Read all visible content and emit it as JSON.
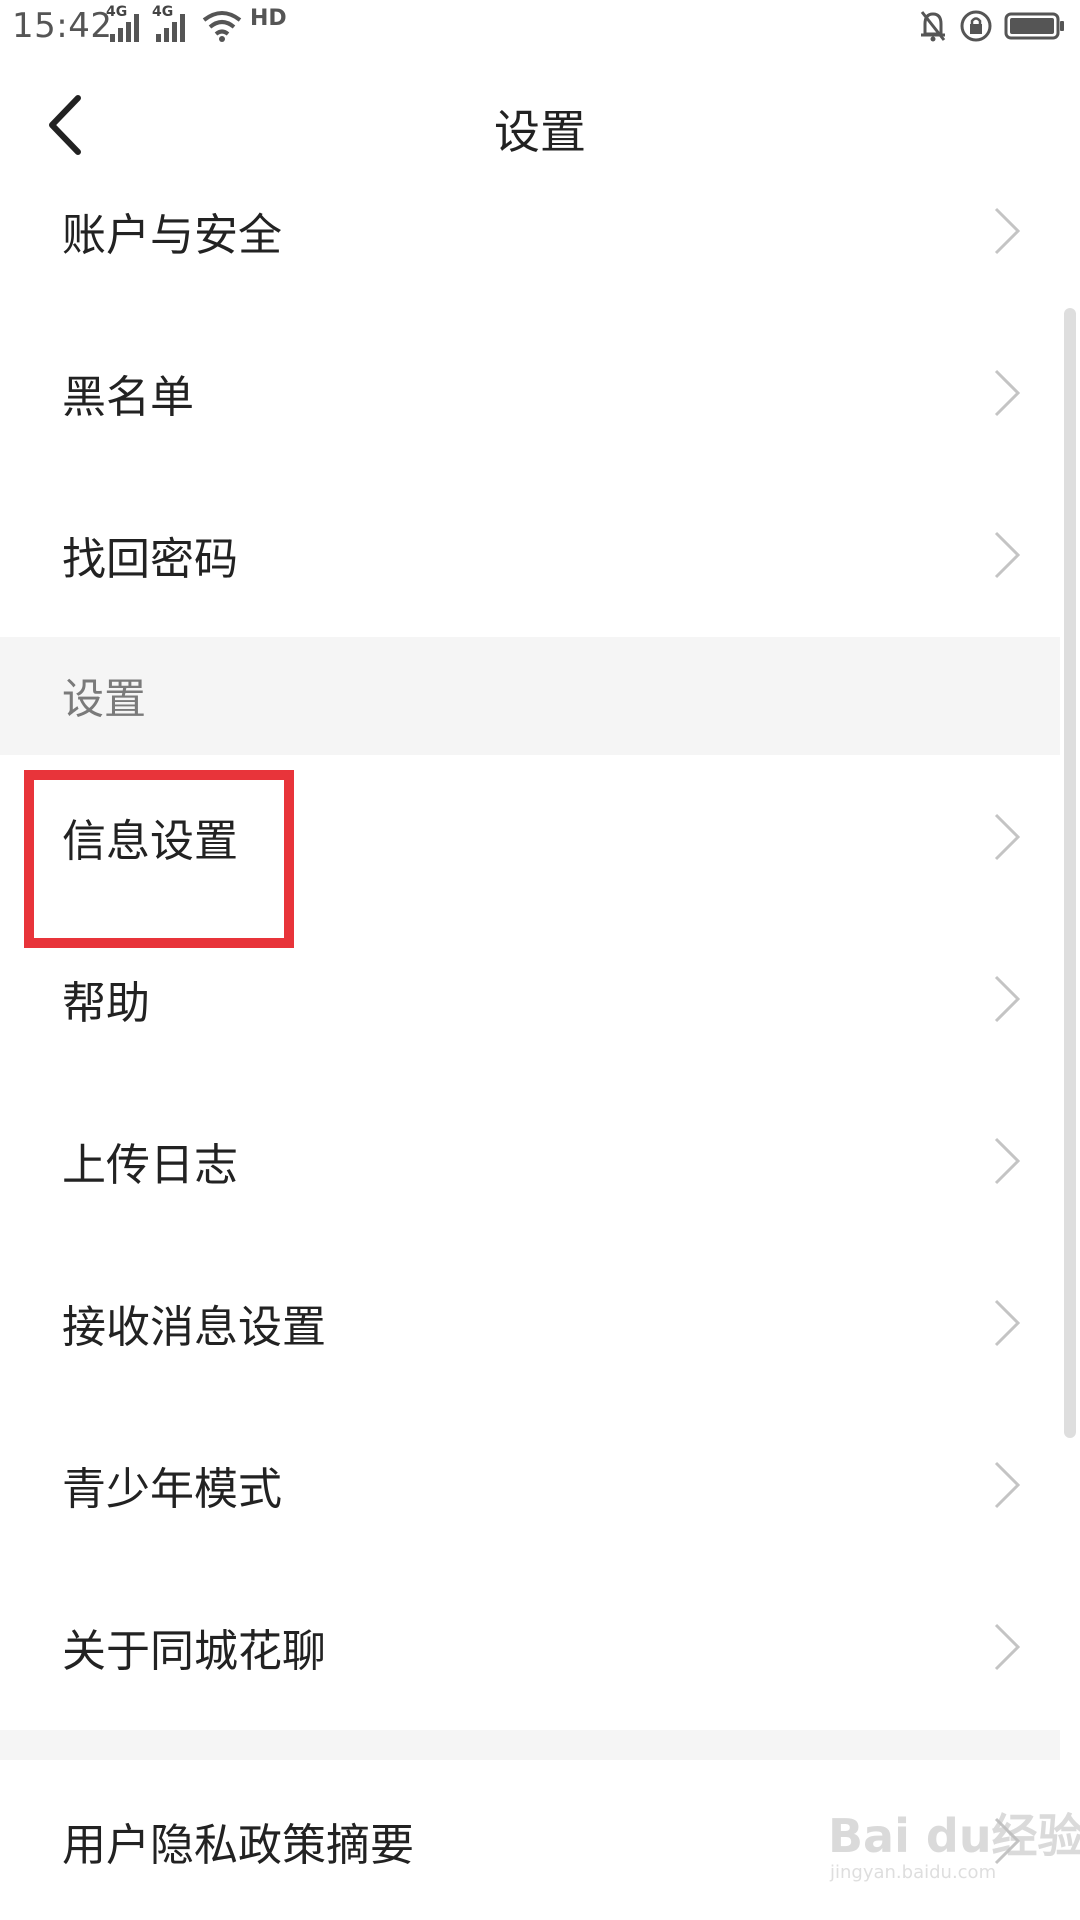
{
  "status_bar": {
    "time": "15:42",
    "signal1_label": "4G",
    "signal2_label": "4G",
    "hd_label": "HD",
    "icons": [
      "signal-icon",
      "signal-icon",
      "wifi-icon",
      "hd-icon",
      "bell-off-icon",
      "rotation-lock-icon",
      "battery-icon"
    ]
  },
  "header": {
    "title": "设置",
    "back_icon": "chevron-left-icon"
  },
  "list": {
    "rows": [
      {
        "label": "账户与安全"
      },
      {
        "label": "黑名单"
      },
      {
        "label": "找回密码"
      }
    ],
    "section": {
      "label": "设置"
    },
    "rows2": [
      {
        "label": "信息设置"
      },
      {
        "label": "帮助"
      },
      {
        "label": "上传日志"
      },
      {
        "label": "接收消息设置"
      },
      {
        "label": "青少年模式"
      },
      {
        "label": "关于同城花聊"
      }
    ],
    "rows3": [
      {
        "label": "用户隐私政策摘要"
      }
    ]
  },
  "annotation": {
    "color": "#e8343a"
  },
  "watermark": {
    "main": "Bai du经验",
    "sub": "jingyan.baidu.com"
  }
}
